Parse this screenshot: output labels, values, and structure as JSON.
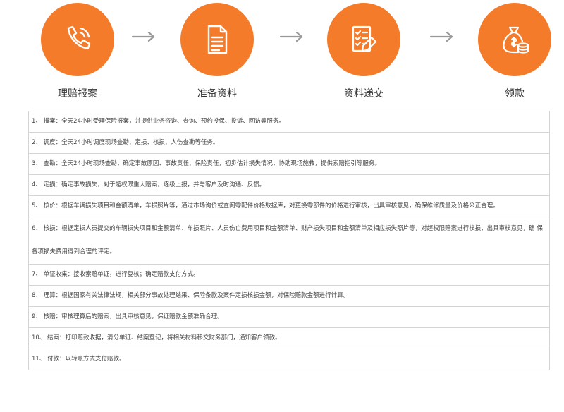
{
  "steps": [
    {
      "label": "理赔报案",
      "icon": "phone-icon"
    },
    {
      "label": "准备资料",
      "icon": "document-icon"
    },
    {
      "label": "资料递交",
      "icon": "checklist-icon"
    },
    {
      "label": "领款",
      "icon": "money-bag-icon"
    }
  ],
  "colors": {
    "accent": "#f47b2a",
    "arrow": "#999999",
    "border": "#d4d4d4"
  },
  "items": [
    "1、 报案：全天24小时受理保险报案，并提供业务咨询、查询、预约投保、投诉、回访等服务。",
    "2、 调度：全天24小时调度现场查勘、定损、核损、人伤查勘等任务。",
    "3、 查勘：全天24小时现场查勘，确定事故原因、事故责任、保险责任，初步估计损失情况，协助现场施救，提供索赔指引等服务。",
    "4、 定损：确定事故损失，对于超权限重大赔案，逐级上报，并与客户及时沟通、反馈。",
    "5、 核价：根据车辆损失项目和金额清单，车损照片等，通过市场询价或查阅零配件价格数据库，对更换零部件的价格进行审核，出具审核意见，确保维修质量及价格公正合理。",
    "6、 核损：根据定损人员提交的车辆损失项目和金额清单、车损照片、人员伤亡费用项目和金额清单、财产损失项目和金额清单及相应损失照片等，对超权限赔案进行核损，出具审核意见，确 保各项损失费用得到合理的评定。",
    "7、 单证收集：接收索赔单证，进行复核；确定赔款支付方式。",
    "8、 理算：根据国家有关法律法规，相关部分事故处理结果、保险条款及案件定损核损金额，对保险赔款金额进行计算。",
    "9、 核赔：审核理算后的赔案，出具审核意见，保证赔款金额准确合理。",
    "10、 结案：打印赔款收据，清分单证、结案登记，将相关材料移交财务部门，通知客户领款。",
    "11、 付款：以转账方式支付赔款。"
  ]
}
